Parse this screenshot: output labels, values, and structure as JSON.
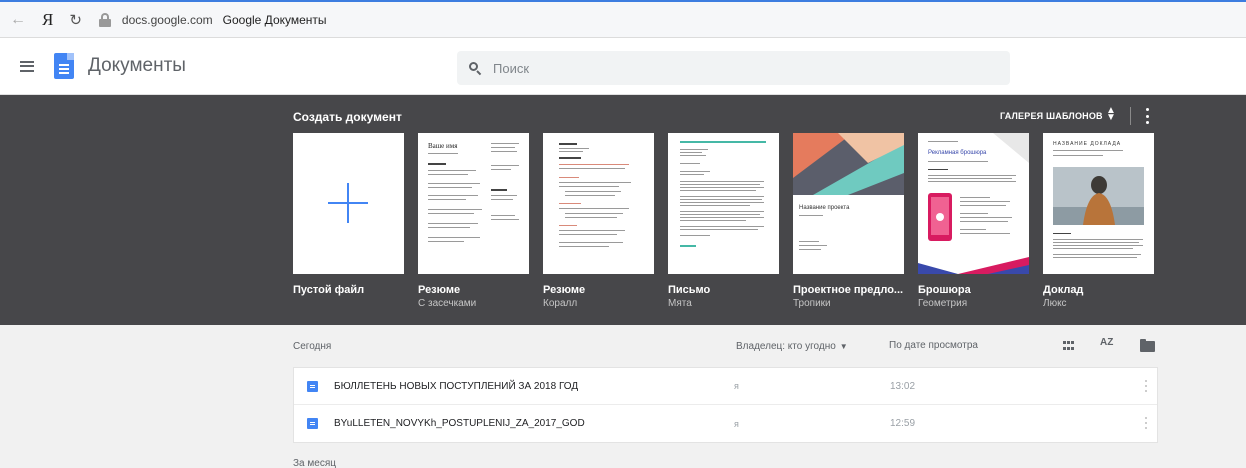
{
  "browser": {
    "domain": "docs.google.com",
    "title": "Google Документы",
    "back_glyph": "←",
    "yandex_glyph": "Я",
    "reload_glyph": "↻"
  },
  "header": {
    "app_title": "Документы",
    "search_placeholder": "Поиск"
  },
  "gallery": {
    "title": "Создать документ",
    "gallery_link": "ГАЛЕРЕЯ ШАБЛОНОВ",
    "templates": [
      {
        "name": "Пустой файл",
        "subtitle": ""
      },
      {
        "name": "Резюме",
        "subtitle": "С засечками"
      },
      {
        "name": "Резюме",
        "subtitle": "Коралл"
      },
      {
        "name": "Письмо",
        "subtitle": "Мята"
      },
      {
        "name": "Проектное предло...",
        "subtitle": "Тропики"
      },
      {
        "name": "Брошюра",
        "subtitle": "Геометрия"
      },
      {
        "name": "Доклад",
        "subtitle": "Люкс"
      }
    ],
    "thumb_text": {
      "resume_name": "Ваше имя",
      "project_title": "Название проекта",
      "brochure_title": "Рекламная брошюра",
      "report_title": "НАЗВАНИЕ ДОКЛАДА"
    }
  },
  "list": {
    "group_today": "Сегодня",
    "owner_filter": "Владелец: кто угодно",
    "sort_label": "По дате просмотра",
    "sort_az": "AZ",
    "documents": [
      {
        "name": "БЮЛЛЕТЕНЬ НОВЫХ ПОСТУПЛЕНИЙ ЗА 2018 ГОД",
        "owner": "я",
        "date": "13:02"
      },
      {
        "name": "BYuLLETEN_NOVYKh_POSTUPLENIJ_ZA_2017_GOD",
        "owner": "я",
        "date": "12:59"
      }
    ],
    "group_month": "За месяц"
  },
  "colors": {
    "accent": "#4285f4",
    "gallery_bg": "#47474a",
    "page_bg": "#f1f1f1"
  }
}
